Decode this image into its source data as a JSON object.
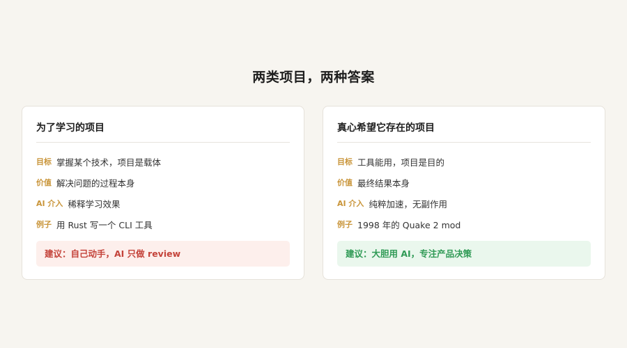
{
  "title": "两类项目，两种答案",
  "colors": {
    "background": "#f7f5f0",
    "tag": "#c9953a",
    "advice_red_text": "#c4433a",
    "advice_red_bg": "#fdefec",
    "advice_green_text": "#2f9a55",
    "advice_green_bg": "#eaf7ed"
  },
  "cards": [
    {
      "title": "为了学习的项目",
      "rows": [
        {
          "label": "目标",
          "value": "掌握某个技术，项目是载体"
        },
        {
          "label": "价值",
          "value": "解决问题的过程本身"
        },
        {
          "label": "AI 介入",
          "value": "稀释学习效果"
        },
        {
          "label": "例子",
          "value": "用 Rust 写一个 CLI 工具"
        }
      ],
      "advice": "建议：自己动手，AI 只做 review"
    },
    {
      "title": "真心希望它存在的项目",
      "rows": [
        {
          "label": "目标",
          "value": "工具能用，项目是目的"
        },
        {
          "label": "价值",
          "value": "最终结果本身"
        },
        {
          "label": "AI 介入",
          "value": "纯粹加速，无副作用"
        },
        {
          "label": "例子",
          "value": "1998 年的 Quake 2 mod"
        }
      ],
      "advice": "建议：大胆用 AI，专注产品决策"
    }
  ]
}
